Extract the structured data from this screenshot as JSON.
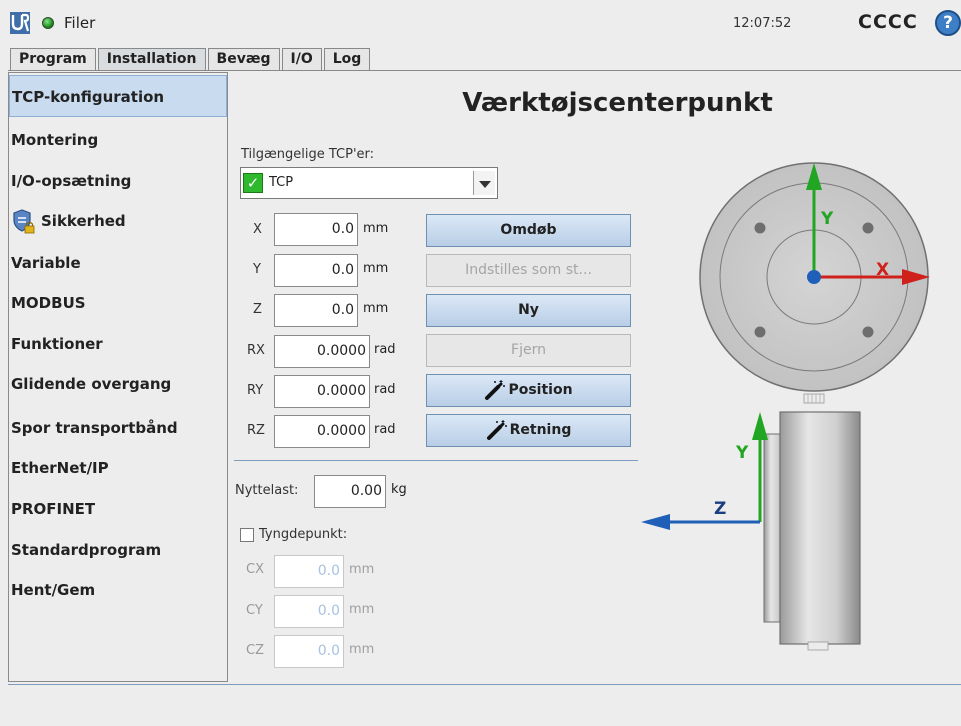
{
  "topbar": {
    "files_label": "Filer",
    "clock": "12:07:52",
    "robot_name": "CCCC",
    "help_icon": "?"
  },
  "tabs": [
    {
      "label": "Program",
      "active": false
    },
    {
      "label": "Installation",
      "active": true
    },
    {
      "label": "Bevæg",
      "active": false
    },
    {
      "label": "I/O",
      "active": false
    },
    {
      "label": "Log",
      "active": false
    }
  ],
  "sidebar": {
    "items": [
      {
        "label": "TCP-konfiguration",
        "active": true
      },
      {
        "label": "Montering"
      },
      {
        "label": "I/O-opsætning"
      },
      {
        "label": "Sikkerhed",
        "icon": "shield-lock-icon"
      },
      {
        "label": "Variable"
      },
      {
        "label": "MODBUS"
      },
      {
        "label": "Funktioner"
      },
      {
        "label": "Glidende overgang"
      },
      {
        "label": "Spor transportbånd"
      },
      {
        "label": "EtherNet/IP"
      },
      {
        "label": "PROFINET"
      },
      {
        "label": "Standardprogram"
      },
      {
        "label": "Hent/Gem"
      }
    ]
  },
  "main": {
    "title": "Værktøjscenterpunkt",
    "available_label": "Tilgængelige TCP'er:",
    "tcp_selected": "TCP",
    "fields": [
      {
        "label": "X",
        "value": "0.0",
        "unit": "mm"
      },
      {
        "label": "Y",
        "value": "0.0",
        "unit": "mm"
      },
      {
        "label": "Z",
        "value": "0.0",
        "unit": "mm"
      },
      {
        "label": "RX",
        "value": "0.0000",
        "unit": "rad"
      },
      {
        "label": "RY",
        "value": "0.0000",
        "unit": "rad"
      },
      {
        "label": "RZ",
        "value": "0.0000",
        "unit": "rad"
      }
    ],
    "buttons": {
      "rename": "Omdøb",
      "set_default": "Indstilles som st...",
      "new": "Ny",
      "remove": "Fjern",
      "position": "Position",
      "orientation": "Retning"
    },
    "payload_label": "Nyttelast:",
    "payload_value": "0.00",
    "payload_unit": "kg",
    "cog_label": "Tyngdepunkt:",
    "cog_fields": [
      {
        "label": "CX",
        "value": "0.0",
        "unit": "mm"
      },
      {
        "label": "CY",
        "value": "0.0",
        "unit": "mm"
      },
      {
        "label": "CZ",
        "value": "0.0",
        "unit": "mm"
      }
    ]
  },
  "diagram": {
    "axis_x": "X",
    "axis_y": "Y",
    "axis_z": "Z",
    "colors": {
      "x": "#d0201c",
      "y": "#22a522",
      "z": "#1f5fb8"
    }
  }
}
